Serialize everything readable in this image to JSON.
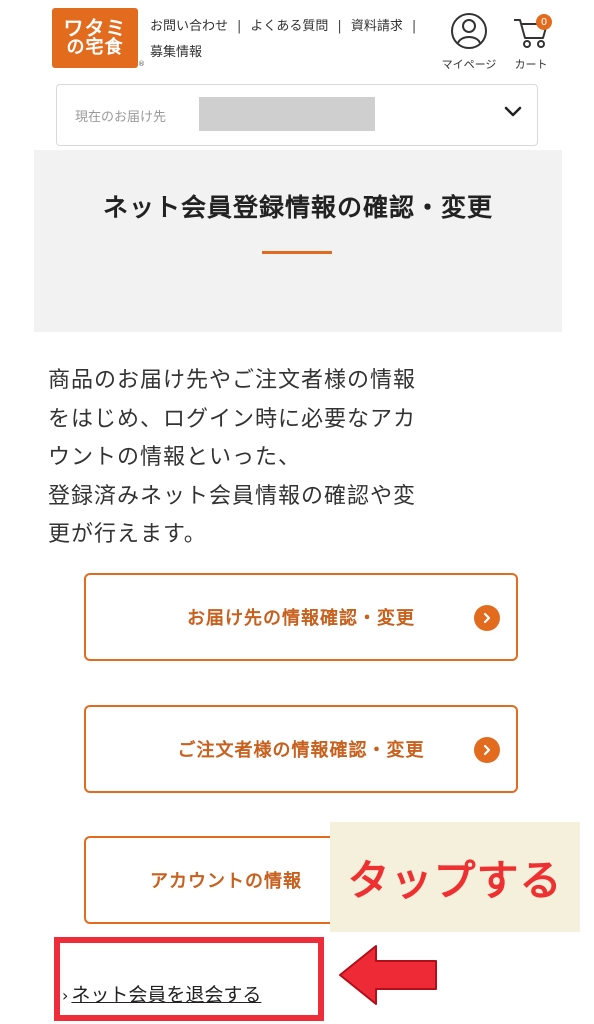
{
  "header": {
    "logo_line1": "ワタミ",
    "logo_line2": "の宅食",
    "logo_reg": "®",
    "links": [
      "お問い合わせ",
      "よくある質問",
      "資料請求",
      "募集情報"
    ],
    "separator": "|",
    "mypage_label": "マイページ",
    "cart_label": "カート",
    "cart_count": "0",
    "icons": {
      "mypage": "user-circle-icon",
      "cart": "cart-icon"
    }
  },
  "delivery": {
    "label": "現在のお届け先",
    "chevron": "chevron-down-icon"
  },
  "page": {
    "title": "ネット会員登録情報の確認・変更",
    "intro_lines": [
      "商品のお届け先やご注文者様の情報",
      "をはじめ、ログイン時に必要なアカ",
      "ウントの情報といった、",
      "登録済みネット会員情報の確認や変",
      "更が行えます。"
    ]
  },
  "buttons": [
    {
      "label": "お届け先の情報確認・変更"
    },
    {
      "label": "ご注文者様の情報確認・変更"
    },
    {
      "label": "アカウントの情報"
    }
  ],
  "annotation": {
    "callout": "タップする"
  },
  "leave": {
    "caret": "›",
    "label": "ネット会員を退会する"
  },
  "colors": {
    "accent": "#e36b1e",
    "annotation_red": "#ef2d3a",
    "callout_bg": "#f5f0dc",
    "banner_bg": "#f2f2f2"
  }
}
